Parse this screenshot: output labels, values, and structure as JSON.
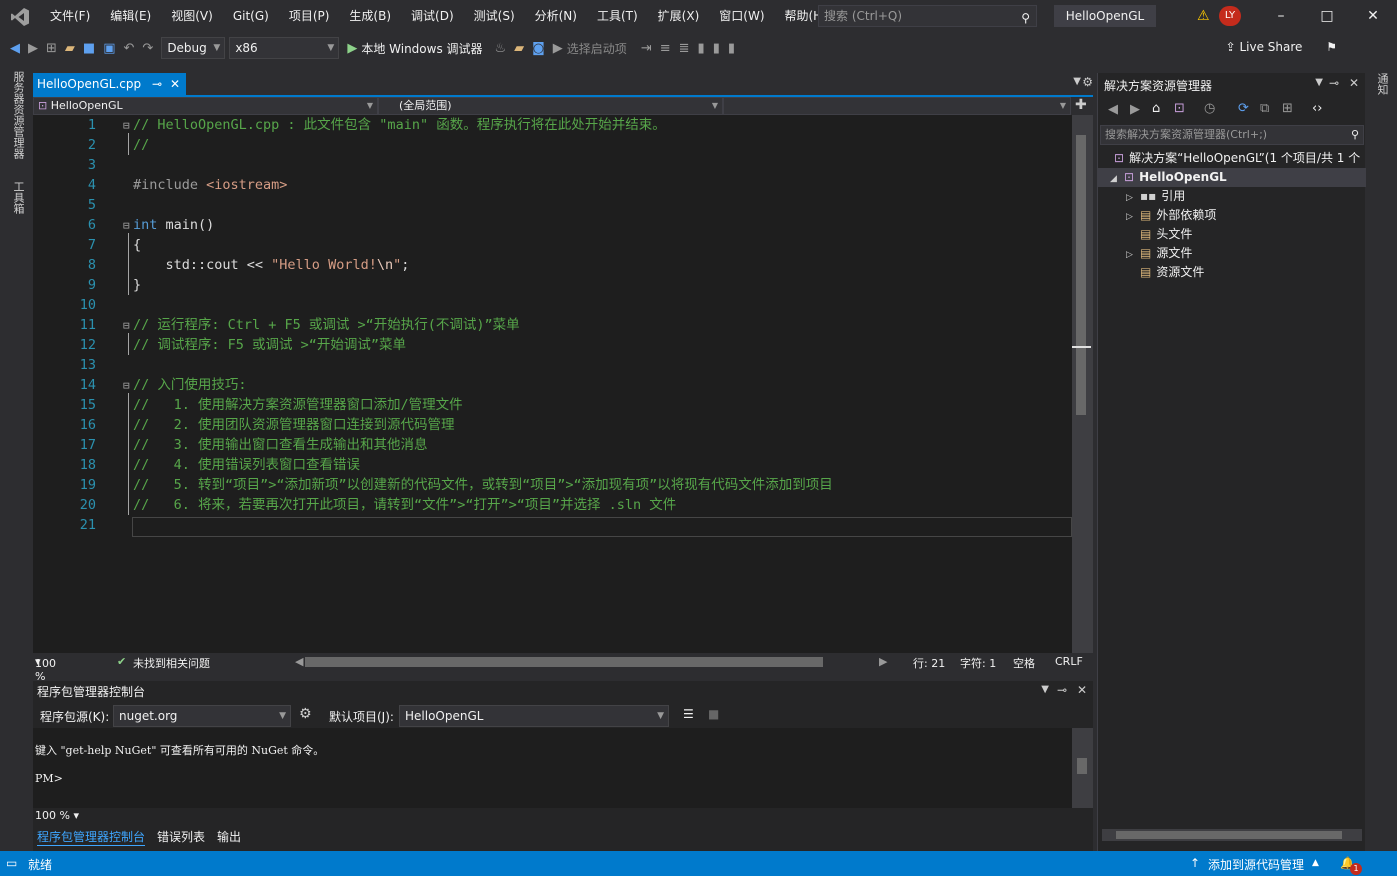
{
  "menu": [
    "文件(F)",
    "编辑(E)",
    "视图(V)",
    "Git(G)",
    "项目(P)",
    "生成(B)",
    "调试(D)",
    "测试(S)",
    "分析(N)",
    "工具(T)",
    "扩展(X)",
    "窗口(W)",
    "帮助(H)"
  ],
  "search": {
    "placeholder": "搜索 (Ctrl+Q)"
  },
  "project_title": "HelloOpenGL",
  "avatar": "LY",
  "toolbar": {
    "config": "Debug",
    "platform": "x86",
    "run": "本地 Windows 调试器",
    "startup": "选择启动项",
    "live_share": "Live Share"
  },
  "left_rail": {
    "server_explorer": "服务器资源管理器",
    "toolbox": "工具箱"
  },
  "right_rail": {
    "notifications": "通知"
  },
  "editor": {
    "tab_name": "HelloOpenGL.cpp",
    "nav_project": "HelloOpenGL",
    "nav_scope": "(全局范围)",
    "lines": [
      "1",
      "2",
      "3",
      "4",
      "5",
      "6",
      "7",
      "8",
      "9",
      "10",
      "11",
      "12",
      "13",
      "14",
      "15",
      "16",
      "17",
      "18",
      "19",
      "20",
      "21"
    ],
    "code": {
      "l1": "// HelloOpenGL.cpp : 此文件包含 \"main\" 函数。程序执行将在此处开始并结束。",
      "l2": "//",
      "l4a": "#include ",
      "l4b": "<iostream>",
      "l6a": "int",
      "l6b": " main()",
      "l7": "{",
      "l8a": "    std::cout << ",
      "l8b": "\"Hello World!",
      "l8c": "\\n",
      "l8d": "\"",
      "l8e": ";",
      "l9": "}",
      "l11": "// 运行程序: Ctrl + F5 或调试 >“开始执行(不调试)”菜单",
      "l12": "// 调试程序: F5 或调试 >“开始调试”菜单",
      "l14": "// 入门使用技巧: ",
      "l15": "//   1. 使用解决方案资源管理器窗口添加/管理文件",
      "l16": "//   2. 使用团队资源管理器窗口连接到源代码管理",
      "l17": "//   3. 使用输出窗口查看生成输出和其他消息",
      "l18": "//   4. 使用错误列表窗口查看错误",
      "l19": "//   5. 转到“项目”>“添加新项”以创建新的代码文件，或转到“项目”>“添加现有项”以将现有代码文件添加到项目",
      "l20": "//   6. 将来，若要再次打开此项目，请转到“文件”>“打开”>“项目”并选择 .sln 文件"
    },
    "zoom": "100 %",
    "issues": "未找到相关问题",
    "line_pos": "行: 21",
    "char_pos": "字符: 1",
    "indent": "空格",
    "eol": "CRLF"
  },
  "solution": {
    "title": "解决方案资源管理器",
    "search_placeholder": "搜索解决方案资源管理器(Ctrl+;)",
    "root": "解决方案“HelloOpenGL”(1 个项目/共 1 个",
    "project": "HelloOpenGL",
    "items": [
      "引用",
      "外部依赖项",
      "头文件",
      "源文件",
      "资源文件"
    ]
  },
  "pkg": {
    "title": "程序包管理器控制台",
    "source_label": "程序包源(K):",
    "source": "nuget.org",
    "default_label": "默认项目(J):",
    "default_project": "HelloOpenGL",
    "hint": "键入 \"get-help NuGet\" 可查看所有可用的 NuGet 命令。",
    "prompt": "PM>",
    "zoom": "100 %"
  },
  "bottom_tabs": [
    "程序包管理器控制台",
    "错误列表",
    "输出"
  ],
  "status": {
    "ready": "就绪",
    "source_control": "添加到源代码管理",
    "notif_count": "1"
  },
  "colors": {
    "accent": "#007acc",
    "comment": "#57a64a",
    "keyword": "#569cd6",
    "string": "#d69d85",
    "line_number": "#2b91af"
  }
}
